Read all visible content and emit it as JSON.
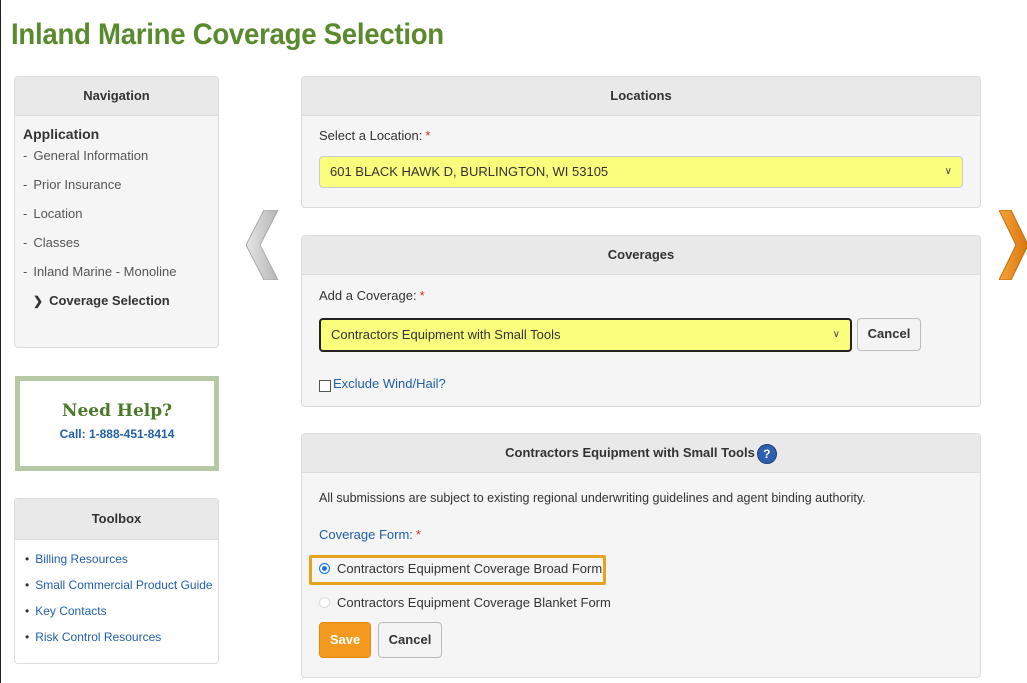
{
  "page": {
    "title": "Inland Marine Coverage Selection"
  },
  "navigation": {
    "header": "Navigation",
    "section": "Application",
    "items": [
      {
        "label": "General Information"
      },
      {
        "label": "Prior Insurance"
      },
      {
        "label": "Location"
      },
      {
        "label": "Classes"
      },
      {
        "label": "Inland Marine - Monoline"
      }
    ],
    "current": "Coverage Selection"
  },
  "help": {
    "title": "Need Help?",
    "phone": "Call: 1-888-451-8414"
  },
  "toolbox": {
    "header": "Toolbox",
    "links": [
      "Billing Resources",
      "Small Commercial Product Guide",
      "Key Contacts",
      "Risk Control Resources"
    ]
  },
  "locations": {
    "header": "Locations",
    "label": "Select a Location:",
    "required": "*",
    "selected": "601 BLACK HAWK D, BURLINGTON, WI 53105"
  },
  "coverages": {
    "header": "Coverages",
    "label": "Add a Coverage:",
    "required": "*",
    "selected": "Contractors Equipment with Small Tools",
    "cancel_label": "Cancel",
    "exclude_label": "Exclude Wind/Hail?"
  },
  "contractors_equipment": {
    "header": "Contractors Equipment with Small Tools",
    "help_icon": "?",
    "notice": "All submissions are subject to existing regional underwriting guidelines and agent binding authority.",
    "form_label": "Coverage Form:",
    "required": "*",
    "options": [
      {
        "label": "Contractors Equipment Coverage Broad Form",
        "checked": true
      },
      {
        "label": "Contractors Equipment Coverage Blanket Form",
        "checked": false
      }
    ],
    "save_label": "Save",
    "cancel_label": "Cancel"
  },
  "colors": {
    "title_green": "#5a8a2e",
    "highlight_yellow": "#fbfd7c",
    "save_orange": "#f39a1e",
    "focus_outline": "#e8a31c",
    "link_blue": "#1f5fa8"
  }
}
